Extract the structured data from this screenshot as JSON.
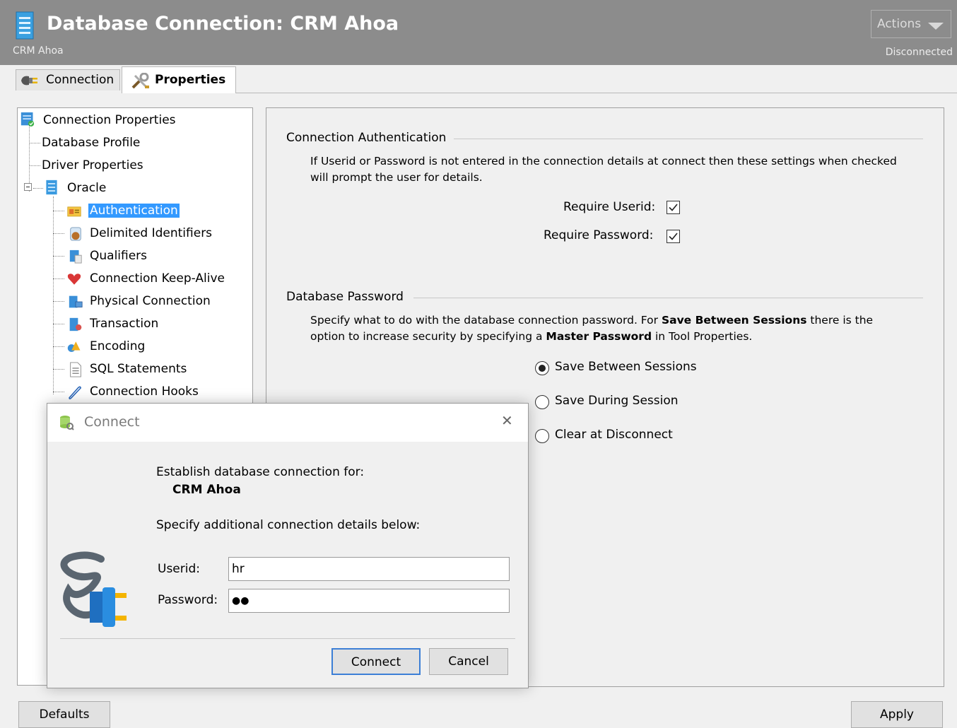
{
  "header": {
    "title": "Database Connection: CRM Ahoa",
    "subtitle": "CRM Ahoa",
    "status": "Disconnected",
    "actions_label": "Actions"
  },
  "tabs": [
    {
      "label": "Connection",
      "icon": "plug-icon"
    },
    {
      "label": "Properties",
      "icon": "tools-icon"
    }
  ],
  "tree": {
    "root": "Connection Properties",
    "items": [
      "Database Profile",
      "Driver Properties",
      "Oracle"
    ],
    "oracle_children": [
      {
        "label": "Authentication",
        "icon": "id-card-icon",
        "selected": true
      },
      {
        "label": "Delimited Identifiers",
        "icon": "jar-icon"
      },
      {
        "label": "Qualifiers",
        "icon": "qualifier-icon"
      },
      {
        "label": "Connection Keep-Alive",
        "icon": "heart-icon"
      },
      {
        "label": "Physical Connection",
        "icon": "server-icon"
      },
      {
        "label": "Transaction",
        "icon": "transaction-icon"
      },
      {
        "label": "Encoding",
        "icon": "encoding-icon"
      },
      {
        "label": "SQL Statements",
        "icon": "document-icon"
      },
      {
        "label": "Connection Hooks",
        "icon": "link-icon"
      }
    ]
  },
  "auth": {
    "title": "Connection Authentication",
    "desc_line1": "If Userid or Password is not entered in the connection details at connect then these settings when checked",
    "desc_line2": "will prompt the user for details.",
    "require_userid_label": "Require Userid:",
    "require_password_label": "Require Password:",
    "require_userid": true,
    "require_password": true
  },
  "password": {
    "title": "Database Password",
    "desc_pre": "Specify what to do with the database connection password. For ",
    "desc_bold1": "Save Between Sessions",
    "desc_mid": " there is the",
    "desc_line2_pre": "option to increase security by specifying a ",
    "desc_bold2": "Master Password",
    "desc_post": " in Tool Properties.",
    "options": [
      "Save Between Sessions",
      "Save During Session",
      "Clear at Disconnect"
    ],
    "selected": "Save Between Sessions"
  },
  "footer": {
    "defaults_label": "Defaults",
    "apply_label": "Apply"
  },
  "dialog": {
    "title": "Connect",
    "establish": "Establish database connection for:",
    "conn_name": "CRM Ahoa",
    "specify": "Specify additional connection details below:",
    "userid_label": "Userid:",
    "userid_value": "hr",
    "password_label": "Password:",
    "password_value": "●●",
    "connect_label": "Connect",
    "cancel_label": "Cancel",
    "close_glyph": "✕"
  }
}
